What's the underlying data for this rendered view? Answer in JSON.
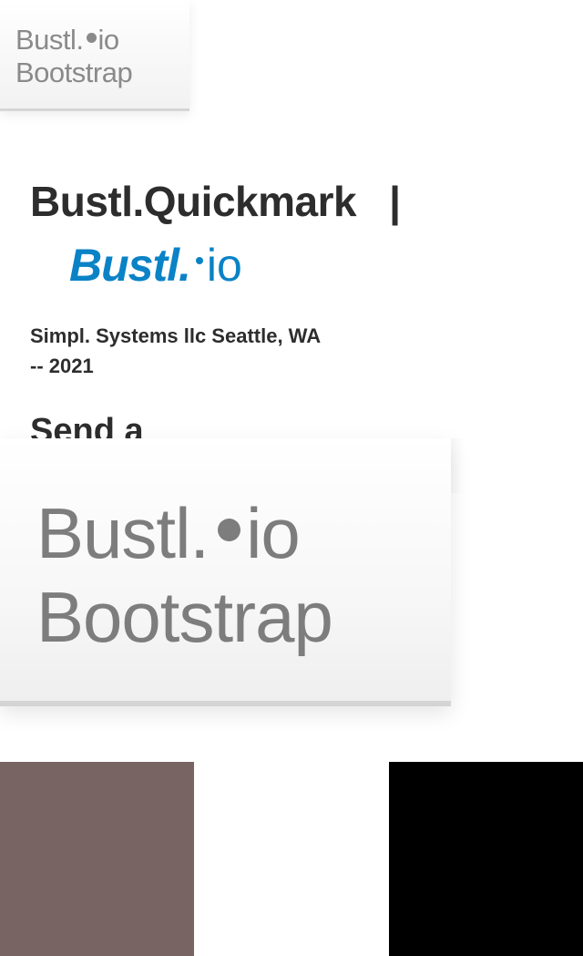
{
  "brand_small": {
    "line1": "Bustl.",
    "line1_tail": "io",
    "line2": "Bootstrap"
  },
  "header": {
    "title": "Bustl.Quickmark",
    "separator": "|"
  },
  "logo": {
    "word": "Bustl.",
    "suffix": "io",
    "color": "#0a82c6"
  },
  "company": {
    "text": "Simpl. Systems llc Seattle, WA -- 2021"
  },
  "send": {
    "heading": "Send a"
  },
  "brand_large": {
    "line1": "Bustl.",
    "line1_tail": "io",
    "line2": "Bootstrap"
  },
  "swatches": {
    "colors": [
      "#786563",
      "#ffffff",
      "#000000"
    ]
  }
}
